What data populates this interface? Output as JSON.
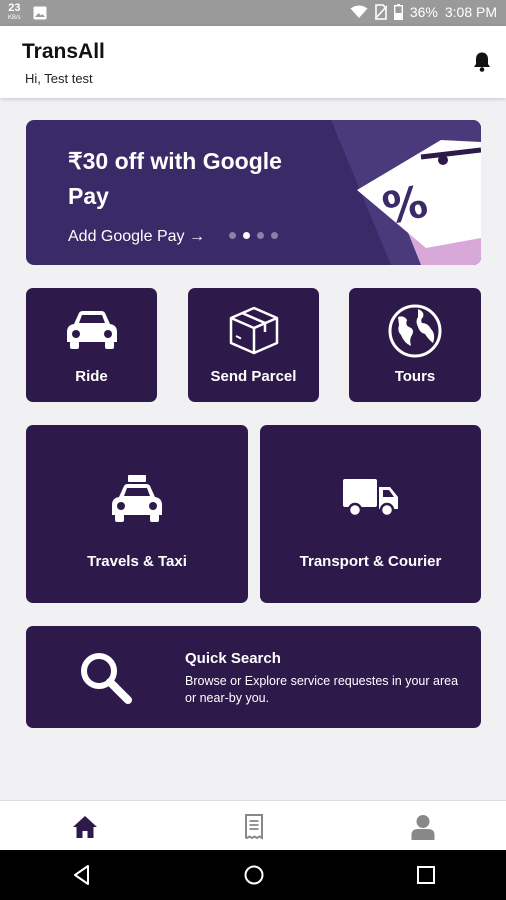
{
  "status_bar": {
    "speed_value": "23",
    "speed_unit": "KB/s",
    "battery": "36%",
    "time": "3:08 PM"
  },
  "header": {
    "title": "TransAll",
    "greeting": "Hi, Test test"
  },
  "banner": {
    "title": "₹30 off with Google Pay",
    "link": "Add Google Pay →",
    "dot_count": 4,
    "active_dot": 1
  },
  "services": {
    "ride": "Ride",
    "send_parcel": "Send Parcel",
    "tours": "Tours",
    "travels_taxi": "Travels & Taxi",
    "transport_courier": "Transport & Courier"
  },
  "quick_search": {
    "title": "Quick Search",
    "description": "Browse or Explore service requestes in your area or near-by you."
  },
  "colors": {
    "tile": "#2e1a4a",
    "banner": "#3a2a68",
    "nav_active": "#2e1a4a",
    "nav_inactive": "#888888"
  },
  "icons": {
    "bell": "bell-icon",
    "ride": "car-icon",
    "parcel": "package-box-icon",
    "tours": "globe-icon",
    "taxi": "taxi-icon",
    "transport": "truck-icon",
    "search": "search-icon",
    "home": "home-icon",
    "bookings": "receipt-icon",
    "profile": "user-icon"
  }
}
